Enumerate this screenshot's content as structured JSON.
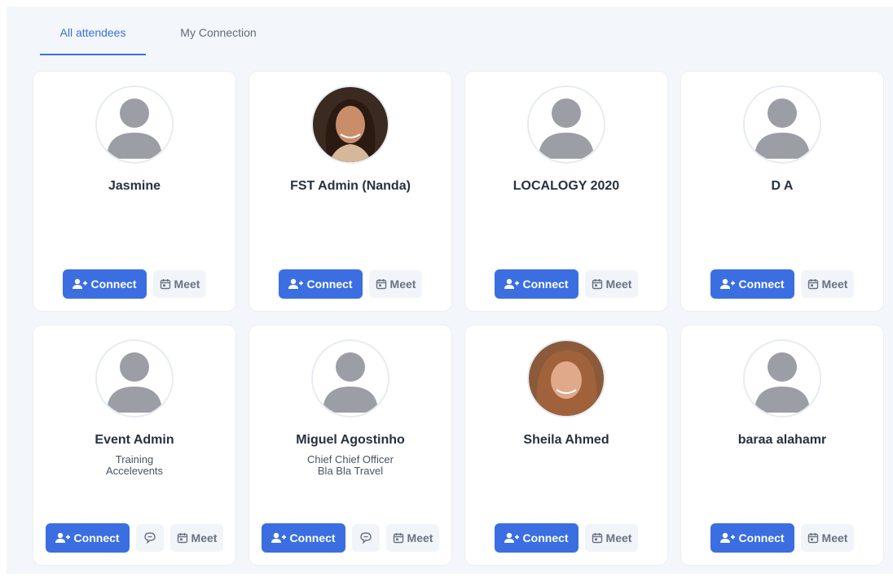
{
  "tabs": [
    {
      "label": "All attendees",
      "active": true
    },
    {
      "label": "My Connection",
      "active": false
    }
  ],
  "colors": {
    "accent": "#3b6ee0",
    "panel_bg": "#f3f7fb",
    "card_bg": "#ffffff"
  },
  "attendees": [
    {
      "name": "Jasmine",
      "line1": "",
      "line2": "",
      "avatar": "placeholder-person-icon",
      "connect_label": "Connect",
      "meet_label": "Meet",
      "has_chat": false
    },
    {
      "name": "FST Admin (Nanda)",
      "line1": "",
      "line2": "",
      "avatar": "photo",
      "connect_label": "Connect",
      "meet_label": "Meet",
      "has_chat": false
    },
    {
      "name": "LOCALOGY 2020",
      "line1": "",
      "line2": "",
      "avatar": "placeholder-person-icon",
      "connect_label": "Connect",
      "meet_label": "Meet",
      "has_chat": false
    },
    {
      "name": "D A",
      "line1": "",
      "line2": "",
      "avatar": "placeholder-person-icon",
      "connect_label": "Connect",
      "meet_label": "Meet",
      "has_chat": false
    },
    {
      "name": "Event Admin",
      "line1": "Training",
      "line2": "Accelevents",
      "avatar": "placeholder-person-icon",
      "connect_label": "Connect",
      "meet_label": "Meet",
      "has_chat": true
    },
    {
      "name": "Miguel Agostinho",
      "line1": "Chief Chief Officer",
      "line2": "Bla Bla Travel",
      "avatar": "placeholder-person-icon",
      "connect_label": "Connect",
      "meet_label": "Meet",
      "has_chat": true
    },
    {
      "name": "Sheila Ahmed",
      "line1": "",
      "line2": "",
      "avatar": "photo",
      "connect_label": "Connect",
      "meet_label": "Meet",
      "has_chat": false
    },
    {
      "name": "baraa alahamr",
      "line1": "",
      "line2": "",
      "avatar": "placeholder-person-icon",
      "connect_label": "Connect",
      "meet_label": "Meet",
      "has_chat": false
    }
  ]
}
